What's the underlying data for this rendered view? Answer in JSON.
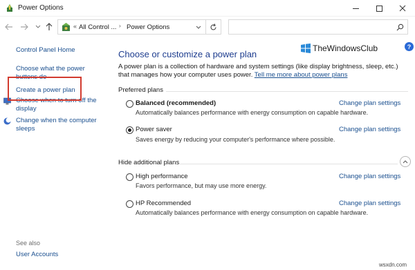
{
  "window": {
    "title": "Power Options"
  },
  "address": {
    "overflow": "«",
    "crumb1": "All Control ...",
    "separator": "›",
    "crumb2": "Power Options"
  },
  "sidebar": {
    "items": [
      {
        "label": "Control Panel Home"
      },
      {
        "label": "Choose what the power buttons do"
      },
      {
        "label": "Create a power plan"
      },
      {
        "label": "Choose when to turn off the display"
      },
      {
        "label": "Change when the computer sleeps"
      }
    ],
    "see_also_label": "See also",
    "see_also_items": [
      {
        "label": "User Accounts"
      }
    ]
  },
  "main": {
    "title": "Choose or customize a power plan",
    "intro_text": "A power plan is a collection of hardware and system settings (like display brightness, sleep, etc.) that manages how your computer uses power. ",
    "intro_link": "Tell me more about power plans",
    "preferred_label": "Preferred plans",
    "hidden_label": "Hide additional plans",
    "plans": [
      {
        "name": "Balanced (recommended)",
        "desc": "Automatically balances performance with energy consumption on capable hardware.",
        "change": "Change plan settings",
        "selected": false
      },
      {
        "name": "Power saver",
        "desc": "Saves energy by reducing your computer's performance where possible.",
        "change": "Change plan settings",
        "selected": true
      },
      {
        "name": "High performance",
        "desc": "Favors performance, but may use more energy.",
        "change": "Change plan settings",
        "selected": false
      },
      {
        "name": "HP Recommended",
        "desc": "Automatically balances performance with energy consumption on capable hardware.",
        "change": "Change plan settings",
        "selected": false
      }
    ]
  },
  "watermark": {
    "text": "TheWindowsClub"
  },
  "credit": "wsxdn.com",
  "colors": {
    "link": "#1a4f8f",
    "title": "#1e3d8f",
    "highlight": "#d23b2f"
  }
}
